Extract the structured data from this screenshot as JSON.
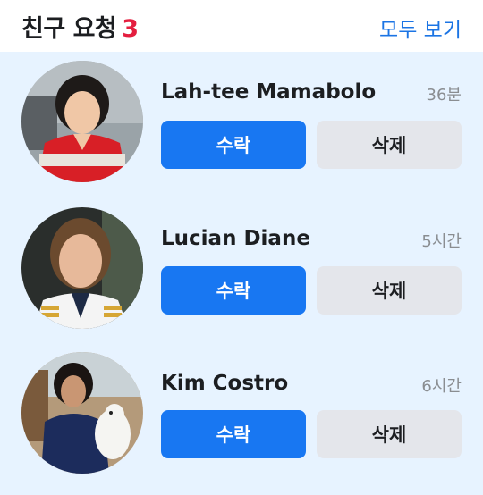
{
  "header": {
    "title": "친구 요청",
    "count": "3",
    "see_all": "모두 보기"
  },
  "requests": [
    {
      "name": "Lah-tee Mamabolo",
      "time": "36분",
      "accept_label": "수락",
      "delete_label": "삭제"
    },
    {
      "name": "Lucian Diane",
      "time": "5시간",
      "accept_label": "수락",
      "delete_label": "삭제"
    },
    {
      "name": "Kim Costro",
      "time": "6시간",
      "accept_label": "수락",
      "delete_label": "삭제"
    }
  ],
  "colors": {
    "accent": "#1877f2",
    "count": "#e41e3f",
    "list_background": "#e7f3ff",
    "secondary_button": "#e4e6eb"
  }
}
